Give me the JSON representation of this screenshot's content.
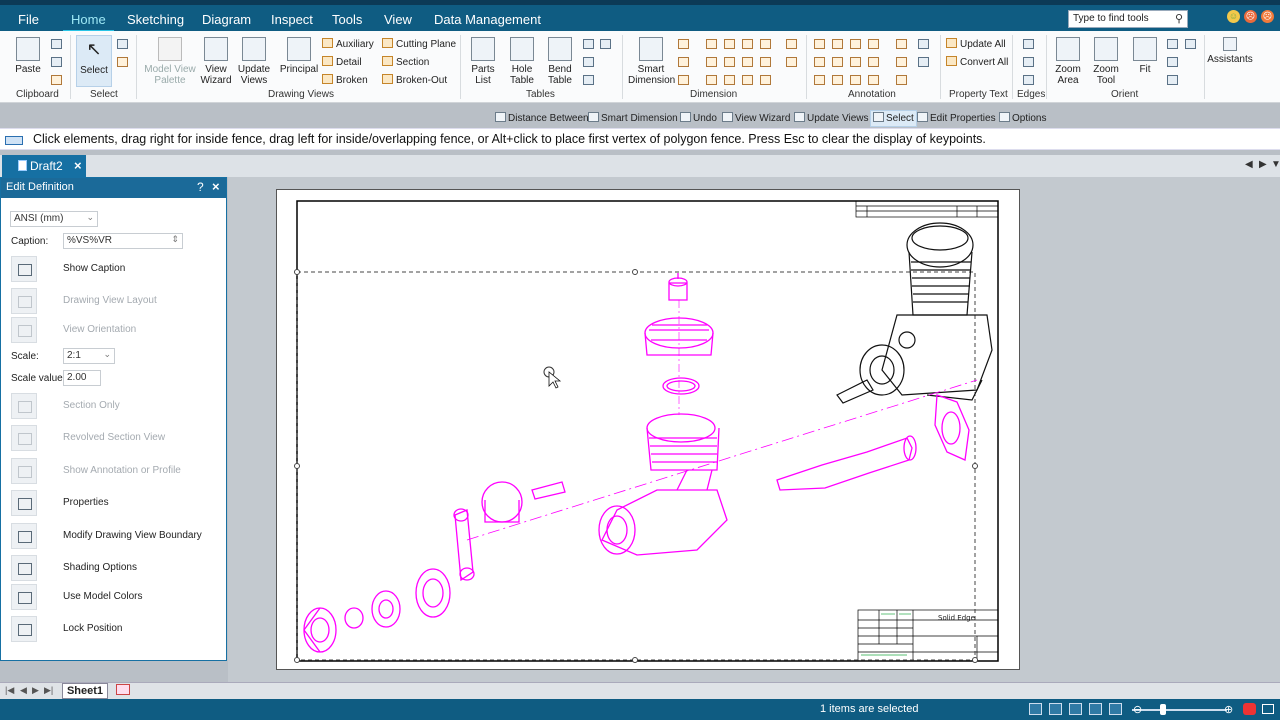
{
  "menu": {
    "items": [
      "File",
      "Home",
      "Sketching",
      "Diagram",
      "Inspect",
      "Tools",
      "View",
      "Data Management"
    ],
    "find_placeholder": "Type to find tools"
  },
  "ribbon": {
    "clipboard": {
      "paste": "Paste",
      "group": "Clipboard"
    },
    "select": {
      "select": "Select",
      "group": "Select"
    },
    "drawing_views": {
      "model_view_palette_1": "Model View",
      "model_view_palette_2": "Palette",
      "view_wizard_1": "View",
      "view_wizard_2": "Wizard",
      "update_views_1": "Update",
      "update_views_2": "Views",
      "principal": "Principal",
      "auxiliary": "Auxiliary",
      "detail": "Detail",
      "broken": "Broken",
      "cutting_plane": "Cutting Plane",
      "section": "Section",
      "broken_out": "Broken-Out",
      "group": "Drawing Views"
    },
    "tables": {
      "parts_list_1": "Parts",
      "parts_list_2": "List",
      "hole_table_1": "Hole",
      "hole_table_2": "Table",
      "bend_table_1": "Bend",
      "bend_table_2": "Table",
      "group": "Tables"
    },
    "dimension": {
      "smart_1": "Smart",
      "smart_2": "Dimension",
      "group": "Dimension"
    },
    "annotation": {
      "group": "Annotation"
    },
    "property_text": {
      "update_all": "Update All",
      "convert_all": "Convert All",
      "group": "Property Text"
    },
    "edges": {
      "group": "Edges"
    },
    "orient": {
      "zoom_area_1": "Zoom",
      "zoom_area_2": "Area",
      "zoom_tool_1": "Zoom",
      "zoom_tool_2": "Tool",
      "fit": "Fit",
      "group": "Orient"
    },
    "assistants": "Assistants"
  },
  "command_bar": [
    "Distance Between",
    "Smart Dimension",
    "Undo",
    "View Wizard",
    "Update Views",
    "Select",
    "Edit Properties",
    "Options"
  ],
  "prompt": "Click elements, drag right for inside fence, drag left for inside/overlapping fence, or Alt+click to place first vertex of polygon fence. Press Esc to clear the display of keypoints.",
  "document_tab": "Draft2",
  "panel": {
    "title": "Edit Definition",
    "help": "?",
    "standard": "ANSI (mm)",
    "caption_label": "Caption:",
    "caption_value": "%VS%VR",
    "scale_label": "Scale:",
    "scale_value_select": "2:1",
    "scale_value_label": "Scale value:",
    "scale_value": "2.00",
    "options": [
      {
        "label": "Show Caption",
        "enabled": true
      },
      {
        "label": "Drawing View Layout",
        "enabled": false
      },
      {
        "label": "View Orientation",
        "enabled": false
      },
      {
        "label": "Section Only",
        "enabled": false
      },
      {
        "label": "Revolved Section View",
        "enabled": false
      },
      {
        "label": "Show Annotation or Profile",
        "enabled": false
      },
      {
        "label": "Properties",
        "enabled": true
      },
      {
        "label": "Modify Drawing View Boundary",
        "enabled": true
      },
      {
        "label": "Shading Options",
        "enabled": true
      },
      {
        "label": "Use Model Colors",
        "enabled": true
      },
      {
        "label": "Lock Position",
        "enabled": true
      }
    ]
  },
  "drawing": {
    "title_block_brand": "Solid Edge",
    "highlight_color": "#ff00ff"
  },
  "sheet_tab": "Sheet1",
  "status": "1 items are selected",
  "colors": {
    "accent": "#0f5c82",
    "highlight": "#ff00ff"
  }
}
